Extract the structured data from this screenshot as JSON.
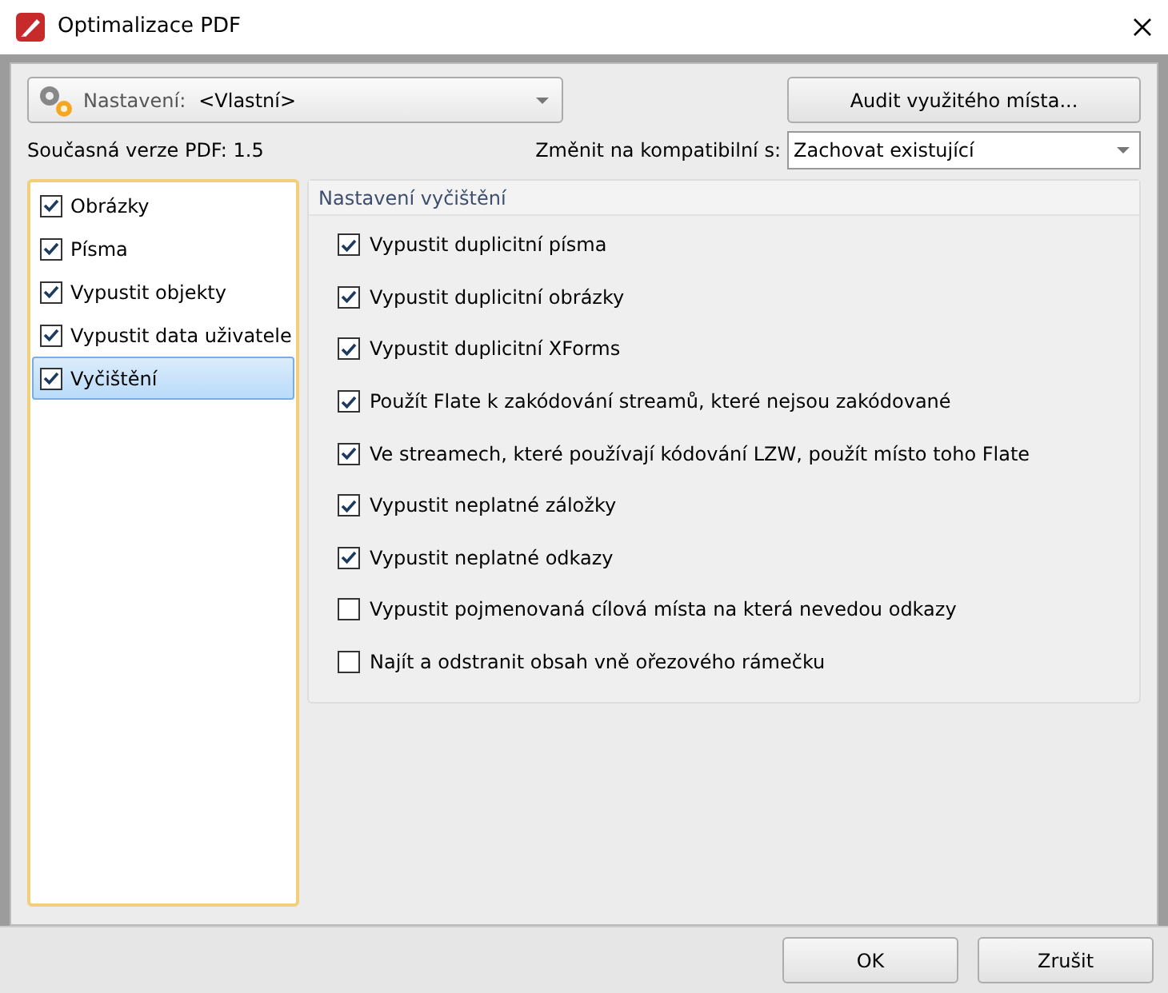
{
  "window": {
    "title": "Optimalizace PDF"
  },
  "preset": {
    "label": "Nastavení:",
    "value": "<Vlastní>"
  },
  "audit_button": "Audit využitého místa...",
  "current_version": "Současná verze PDF: 1.5",
  "compat": {
    "label": "Změnit na kompatibilní s:",
    "value": "Zachovat existující"
  },
  "sidebar": {
    "items": [
      {
        "label": "Obrázky",
        "checked": true,
        "selected": false
      },
      {
        "label": "Písma",
        "checked": true,
        "selected": false
      },
      {
        "label": "Vypustit objekty",
        "checked": true,
        "selected": false
      },
      {
        "label": "Vypustit data uživatele",
        "checked": true,
        "selected": false
      },
      {
        "label": "Vyčištění",
        "checked": true,
        "selected": true
      }
    ]
  },
  "group": {
    "title": "Nastavení vyčištění",
    "options": [
      {
        "label": "Vypustit duplicitní písma",
        "checked": true
      },
      {
        "label": "Vypustit duplicitní obrázky",
        "checked": true
      },
      {
        "label": "Vypustit duplicitní XForms",
        "checked": true
      },
      {
        "label": "Použít Flate k zakódování streamů, které nejsou zakódované",
        "checked": true
      },
      {
        "label": "Ve streamech, které používají kódování LZW, použít místo toho Flate",
        "checked": true
      },
      {
        "label": "Vypustit neplatné záložky",
        "checked": true
      },
      {
        "label": "Vypustit neplatné odkazy",
        "checked": true
      },
      {
        "label": "Vypustit pojmenovaná cílová místa na která nevedou odkazy",
        "checked": false
      },
      {
        "label": "Najít a odstranit obsah vně ořezového rámečku",
        "checked": false
      }
    ]
  },
  "buttons": [
    "OK",
    "Zrušit"
  ]
}
